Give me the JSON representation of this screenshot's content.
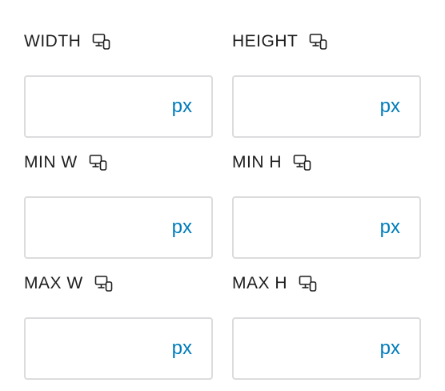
{
  "accent_color": "#007cba",
  "border_color": "#dcdcde",
  "label_color": "#1e1e1e",
  "responsive_icon": "responsive-desktop-icon",
  "fields": {
    "width": {
      "label": "WIDTH",
      "value": "",
      "unit": "px"
    },
    "height": {
      "label": "HEIGHT",
      "value": "",
      "unit": "px"
    },
    "min_w": {
      "label": "MIN W",
      "value": "",
      "unit": "px"
    },
    "min_h": {
      "label": "MIN H",
      "value": "",
      "unit": "px"
    },
    "max_w": {
      "label": "MAX W",
      "value": "",
      "unit": "px"
    },
    "max_h": {
      "label": "MAX H",
      "value": "",
      "unit": "px"
    }
  }
}
